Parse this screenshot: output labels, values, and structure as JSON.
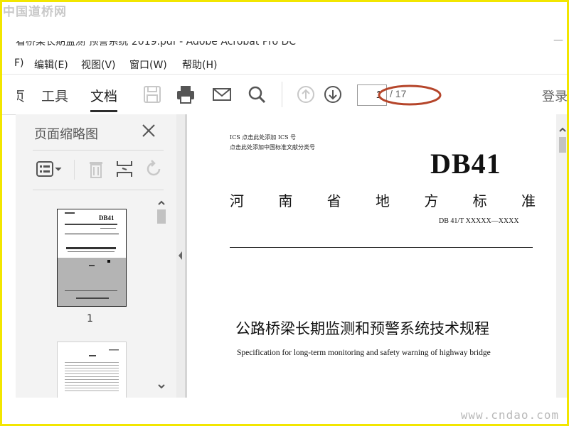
{
  "watermarks": {
    "top": "中国道桥网",
    "bottom": "www.cndao.com"
  },
  "window": {
    "title": "看桥梁长期监测 预警系统 2019.pdf - Adobe Acrobat Pro DC"
  },
  "menu": {
    "items": [
      "F)",
      "编辑(E)",
      "视图(V)",
      "窗口(W)",
      "帮助(H)"
    ]
  },
  "toolbar": {
    "tab_home_partial": "页",
    "tab_tools": "工具",
    "tab_document": "文档",
    "page_current": "1",
    "page_total": "/ 17",
    "login": "登录"
  },
  "sidebar": {
    "title": "页面缩略图",
    "thumb1_label": "1"
  },
  "document": {
    "ics_line": "ICS   点击此处添加 ICS 号",
    "ccs_line": "点击此处添加中国标准文献分类号",
    "code": "DB41",
    "standard_chars": [
      "河",
      "南",
      "省",
      "地",
      "方",
      "标",
      "准"
    ],
    "number": "DB 41/T  XXXXX—XXXX",
    "title_cn": "公路桥梁长期监测和预警系统技术规程",
    "title_en": "Specification for long-term monitoring and safety warning of highway bridge"
  },
  "colors": {
    "frame": "#f2e600",
    "annotation_oval": "#b5452a"
  }
}
